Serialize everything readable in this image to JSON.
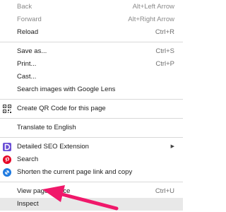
{
  "menu": {
    "back": {
      "label": "Back",
      "shortcut": "Alt+Left Arrow"
    },
    "forward": {
      "label": "Forward",
      "shortcut": "Alt+Right Arrow"
    },
    "reload": {
      "label": "Reload",
      "shortcut": "Ctrl+R"
    },
    "save_as": {
      "label": "Save as...",
      "shortcut": "Ctrl+S"
    },
    "print": {
      "label": "Print...",
      "shortcut": "Ctrl+P"
    },
    "cast": {
      "label": "Cast..."
    },
    "lens": {
      "label": "Search images with Google Lens"
    },
    "qr": {
      "label": "Create QR Code for this page",
      "icon": "qr-code-icon"
    },
    "translate": {
      "label": "Translate to English"
    },
    "seo": {
      "label": "Detailed SEO Extension",
      "icon": "detailed-seo-icon",
      "icon_color": "#6b4fd6",
      "has_submenu": true
    },
    "search": {
      "label": "Search",
      "icon": "pinterest-icon",
      "icon_color": "#e60023"
    },
    "shorten": {
      "label": "Shorten the current page link and copy",
      "icon": "link-shortener-icon",
      "icon_color": "#1f7ae0"
    },
    "view_source": {
      "label": "View page source",
      "shortcut": "Ctrl+U"
    },
    "inspect": {
      "label": "Inspect"
    }
  },
  "annotation": {
    "arrow_color": "#f0186a",
    "points_to": "inspect"
  }
}
